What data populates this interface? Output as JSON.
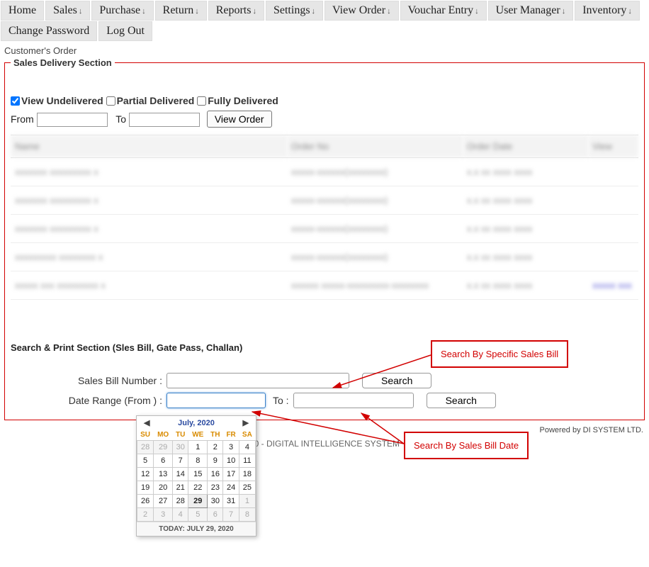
{
  "nav": [
    {
      "label": "Home",
      "dropdown": false
    },
    {
      "label": "Sales",
      "dropdown": true
    },
    {
      "label": "Purchase",
      "dropdown": true
    },
    {
      "label": "Return",
      "dropdown": true
    },
    {
      "label": "Reports",
      "dropdown": true
    },
    {
      "label": "Settings",
      "dropdown": true
    },
    {
      "label": "View Order",
      "dropdown": true
    },
    {
      "label": "Vouchar Entry",
      "dropdown": true
    },
    {
      "label": "User Manager",
      "dropdown": true
    },
    {
      "label": "Inventory",
      "dropdown": true
    },
    {
      "label": "Change Password",
      "dropdown": false
    },
    {
      "label": "Log Out",
      "dropdown": false
    }
  ],
  "page_title": "Customer's Order",
  "legend": "Sales Delivery Section",
  "filters": {
    "undelivered": "View Undelivered",
    "partial": "Partial Delivered",
    "fully": "Fully Delivered",
    "undelivered_checked": true,
    "partial_checked": false,
    "fully_checked": false,
    "from_label": "From",
    "to_label": "To",
    "from_value": "",
    "to_value": "",
    "view_order_btn": "View Order"
  },
  "table": {
    "headers": [
      "Name",
      "Order No",
      "Order Date",
      "View"
    ],
    "rows": [
      {
        "c1": "xxxxxxx xxxxxxxxx x",
        "c2": "xxxxx-xxxxxx(xxxxxxxx)",
        "c3": "x.x xx xxxx xxxx",
        "c4": ""
      },
      {
        "c1": "xxxxxxx xxxxxxxxx x",
        "c2": "xxxxx-xxxxxx(xxxxxxxx)",
        "c3": "x.x xx xxxx xxxx",
        "c4": ""
      },
      {
        "c1": "xxxxxxx xxxxxxxxx x",
        "c2": "xxxxx-xxxxxx(xxxxxxxx)",
        "c3": "x.x xx xxxx xxxx",
        "c4": ""
      },
      {
        "c1": "xxxxxxxxx xxxxxxxx x",
        "c2": "xxxxx-xxxxxx(xxxxxxxx)",
        "c3": "x.x xx xxxx xxxx",
        "c4": ""
      },
      {
        "c1": "xxxxx xxx xxxxxxxxx x",
        "c2": "xxxxxx xxxxx-xxxxxxxxx-xxxxxxxx",
        "c3": "x.x xx xxxx xxxx",
        "c4": "xxxxx xxx"
      }
    ]
  },
  "search_section": {
    "title": "Search & Print Section (Sles Bill, Gate Pass, Challan)",
    "bill_label": "Sales Bill Number :",
    "date_label": "Date Range (From ) :",
    "to_label": "To :",
    "bill_value": "",
    "from_value": "",
    "to_value": "",
    "search_btn": "Search"
  },
  "annotations": {
    "by_bill": "Search By Specific Sales Bill",
    "by_date": "Search By Sales Bill Date"
  },
  "footer_center": "20 - DIGITAL INTELLIGENCE SYSTEM",
  "powered": "Powered by DI SYSTEM LTD.",
  "calendar": {
    "title": "July, 2020",
    "dow": [
      "SU",
      "MO",
      "TU",
      "WE",
      "TH",
      "FR",
      "SA"
    ],
    "weeks": [
      [
        {
          "d": 28,
          "o": true
        },
        {
          "d": 29,
          "o": true
        },
        {
          "d": 30,
          "o": true
        },
        {
          "d": 1
        },
        {
          "d": 2
        },
        {
          "d": 3
        },
        {
          "d": 4
        }
      ],
      [
        {
          "d": 5
        },
        {
          "d": 6
        },
        {
          "d": 7
        },
        {
          "d": 8
        },
        {
          "d": 9
        },
        {
          "d": 10
        },
        {
          "d": 11
        }
      ],
      [
        {
          "d": 12
        },
        {
          "d": 13
        },
        {
          "d": 14
        },
        {
          "d": 15
        },
        {
          "d": 16
        },
        {
          "d": 17
        },
        {
          "d": 18
        }
      ],
      [
        {
          "d": 19
        },
        {
          "d": 20
        },
        {
          "d": 21
        },
        {
          "d": 22
        },
        {
          "d": 23
        },
        {
          "d": 24
        },
        {
          "d": 25
        }
      ],
      [
        {
          "d": 26
        },
        {
          "d": 27
        },
        {
          "d": 28
        },
        {
          "d": 29,
          "today": true
        },
        {
          "d": 30
        },
        {
          "d": 31
        },
        {
          "d": 1,
          "o": true
        }
      ],
      [
        {
          "d": 2,
          "o": true
        },
        {
          "d": 3,
          "o": true
        },
        {
          "d": 4,
          "o": true
        },
        {
          "d": 5,
          "o": true
        },
        {
          "d": 6,
          "o": true
        },
        {
          "d": 7,
          "o": true
        },
        {
          "d": 8,
          "o": true
        }
      ]
    ],
    "footer": "TODAY: JULY 29, 2020"
  }
}
